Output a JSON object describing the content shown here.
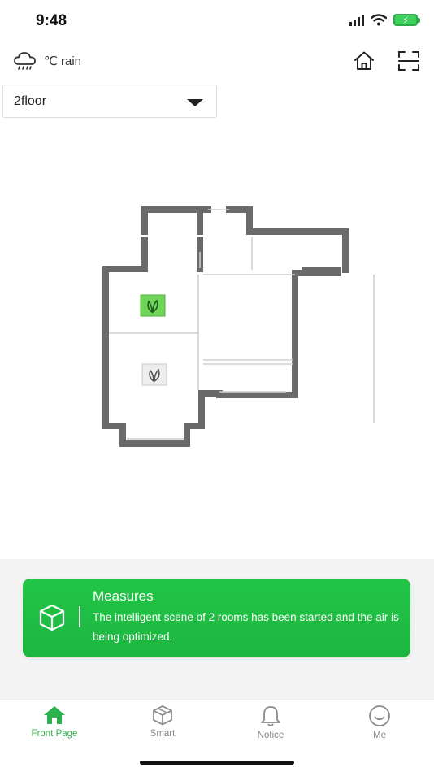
{
  "status_bar": {
    "time": "9:48"
  },
  "header": {
    "weather_icon": "cloud-rain-icon",
    "weather_text": "℃ rain",
    "home_icon": "house-icon",
    "scan_icon": "scan-icon"
  },
  "floor_selector": {
    "value": "2floor"
  },
  "floor_plan": {
    "rooms": [
      {
        "icon": "leaf-icon",
        "state": "active",
        "color": "#6fd65a"
      },
      {
        "icon": "leaf-icon",
        "state": "inactive",
        "color": "#eeeeee"
      }
    ]
  },
  "measures": {
    "icon": "cube-icon",
    "title": "Measures",
    "text": "The intelligent scene of 2 rooms has been started and the air is being optimized."
  },
  "tabs": [
    {
      "label": "Front Page",
      "icon": "home-icon",
      "active": true
    },
    {
      "label": "Smart",
      "icon": "cube-icon",
      "active": false
    },
    {
      "label": "Notice",
      "icon": "bell-icon",
      "active": false
    },
    {
      "label": "Me",
      "icon": "smiley-icon",
      "active": false
    }
  ],
  "colors": {
    "accent": "#2bb24c",
    "card": "#1fbf44",
    "wall": "#6a6a6a"
  }
}
